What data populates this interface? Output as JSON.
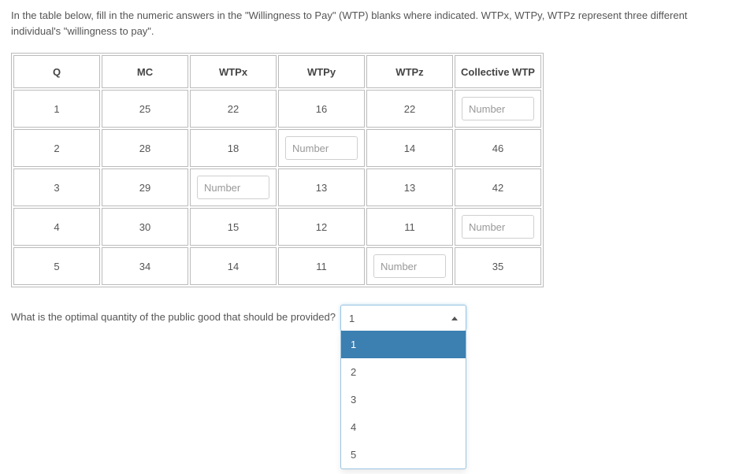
{
  "instructions": "In the table below, fill in the numeric answers in the \"Willingness to Pay\" (WTP) blanks where indicated.  WTPx, WTPy, WTPz  represent three different individual's \"willingness to pay\".",
  "table": {
    "headers": [
      "Q",
      "MC",
      "WTPx",
      "WTPy",
      "WTPz",
      "Collective WTP"
    ],
    "rows": [
      {
        "q": "1",
        "mc": "25",
        "wtpx": {
          "type": "text",
          "value": "22"
        },
        "wtpy": {
          "type": "text",
          "value": "16"
        },
        "wtpz": {
          "type": "text",
          "value": "22"
        },
        "cwtp": {
          "type": "input",
          "placeholder": "Number"
        }
      },
      {
        "q": "2",
        "mc": "28",
        "wtpx": {
          "type": "text",
          "value": "18"
        },
        "wtpy": {
          "type": "input",
          "placeholder": "Number"
        },
        "wtpz": {
          "type": "text",
          "value": "14"
        },
        "cwtp": {
          "type": "text",
          "value": "46"
        }
      },
      {
        "q": "3",
        "mc": "29",
        "wtpx": {
          "type": "input",
          "placeholder": "Number"
        },
        "wtpy": {
          "type": "text",
          "value": "13"
        },
        "wtpz": {
          "type": "text",
          "value": "13"
        },
        "cwtp": {
          "type": "text",
          "value": "42"
        }
      },
      {
        "q": "4",
        "mc": "30",
        "wtpx": {
          "type": "text",
          "value": "15"
        },
        "wtpy": {
          "type": "text",
          "value": "12"
        },
        "wtpz": {
          "type": "text",
          "value": "11"
        },
        "cwtp": {
          "type": "input",
          "placeholder": "Number"
        }
      },
      {
        "q": "5",
        "mc": "34",
        "wtpx": {
          "type": "text",
          "value": "14"
        },
        "wtpy": {
          "type": "text",
          "value": "11"
        },
        "wtpz": {
          "type": "input",
          "placeholder": "Number"
        },
        "cwtp": {
          "type": "text",
          "value": "35"
        }
      }
    ]
  },
  "question": "What is the optimal quantity of the public good that should be provided?",
  "dropdown": {
    "selected": "1",
    "options": [
      "1",
      "2",
      "3",
      "4",
      "5"
    ]
  }
}
